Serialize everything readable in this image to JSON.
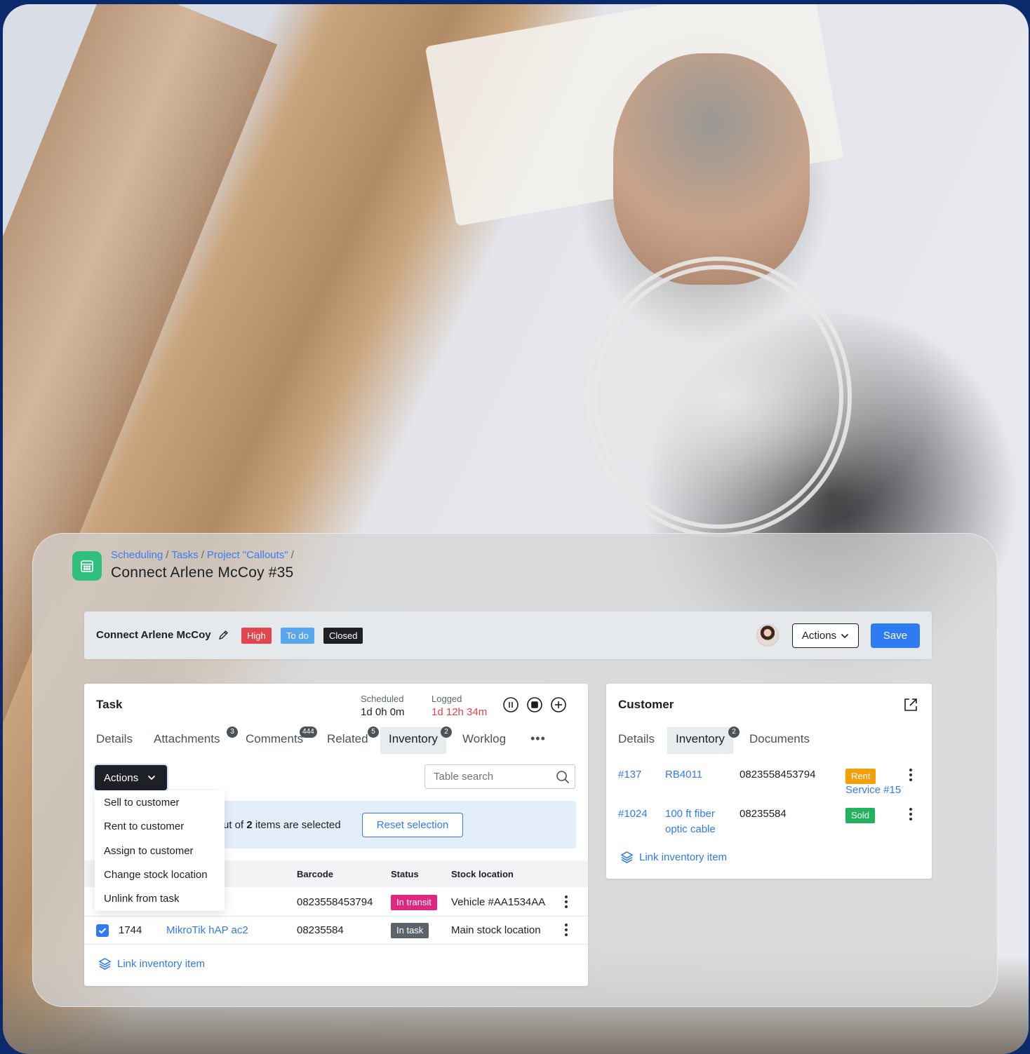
{
  "colors": {
    "accent": "#2f7bf2",
    "app_icon": "#2fbf7c",
    "high": "#e2454e",
    "todo": "#5aa6ee",
    "closed": "#1d2126",
    "in_transit": "#e0267f",
    "in_task": "#5c636b",
    "rent": "#f59f0b",
    "sold": "#22b35e",
    "logged": "#e2454e"
  },
  "breadcrumb": [
    "Scheduling",
    "Tasks",
    "Project \"Callouts\""
  ],
  "breadcrumb_sep": "/",
  "page_title": "Connect Arlene McCoy #35",
  "header": {
    "title": "Connect Arlene McCoy",
    "badges": {
      "priority": "High",
      "state": "To do",
      "closed": "Closed"
    },
    "actions_label": "Actions",
    "save_label": "Save",
    "avatar_icon": "user-avatar"
  },
  "task": {
    "title": "Task",
    "scheduled_label": "Scheduled",
    "scheduled_value": "1d 0h 0m",
    "logged_label": "Logged",
    "logged_value": "1d 12h 34m",
    "controls": [
      "pause-icon",
      "stop-icon",
      "add-icon"
    ],
    "tabs": [
      {
        "label": "Details",
        "count": ""
      },
      {
        "label": "Attachments",
        "count": "3"
      },
      {
        "label": "Comments",
        "count": "444"
      },
      {
        "label": "Related",
        "count": "5"
      },
      {
        "label": "Inventory",
        "count": "2"
      },
      {
        "label": "Worklog",
        "count": ""
      }
    ],
    "more_label": "•••",
    "actions_label": "Actions",
    "search_placeholder": "Table search",
    "selection": {
      "text_prefix": "ut of ",
      "count": "2",
      "text_suffix": " items are selected",
      "reset_label": "Reset selection"
    },
    "columns": [
      "Barcode",
      "Status",
      "Stock location"
    ],
    "rows": [
      {
        "barcode": "0823558453794",
        "status": "In transit",
        "location": "Vehicle #AA1534AA"
      },
      {
        "id": "1744",
        "name": "MikroTik hAP ac2",
        "barcode": "08235584",
        "status": "In task",
        "location": "Main stock location",
        "checked": true
      }
    ],
    "link_inventory_label": "Link inventory item",
    "menu_items": [
      "Sell to customer",
      "Rent to customer",
      "Assign to customer",
      "Change stock location",
      "Unlink from task"
    ]
  },
  "customer": {
    "title": "Customer",
    "tabs": [
      {
        "label": "Details",
        "count": ""
      },
      {
        "label": "Inventory",
        "count": "2"
      },
      {
        "label": "Documents",
        "count": ""
      }
    ],
    "rows": [
      {
        "id": "#137",
        "name": "RB4011",
        "barcode": "0823558453794",
        "badge": "Rent",
        "extra": "Service #15"
      },
      {
        "id": "#1024",
        "name_line1": "100 ft fiber",
        "name_line2": "optic cable",
        "barcode": "08235584",
        "badge": "Sold"
      }
    ],
    "link_inventory_label": "Link inventory item"
  }
}
